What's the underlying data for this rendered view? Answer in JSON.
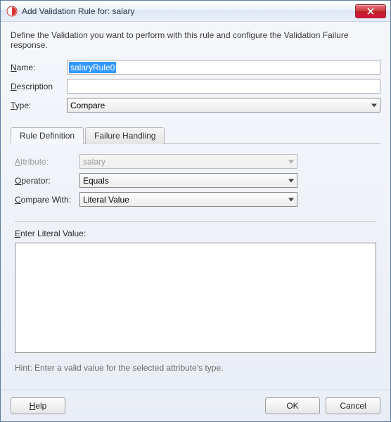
{
  "window": {
    "title": "Add Validation Rule for: salary"
  },
  "intro": "Define the Validation you want to perform with this rule and configure the Validation Failure response.",
  "fields": {
    "name_label": "Name:",
    "name_value": "salaryRule0",
    "description_label": "Description",
    "description_value": "",
    "type_label": "Type:",
    "type_value": "Compare"
  },
  "tabs": {
    "rule_definition": "Rule Definition",
    "failure_handling": "Failure Handling"
  },
  "rule_def": {
    "attribute_label": "Attribute:",
    "attribute_value": "salary",
    "operator_label": "Operator:",
    "operator_value": "Equals",
    "compare_with_label": "Compare With:",
    "compare_with_value": "Literal Value",
    "literal_label": "Enter Literal Value:",
    "literal_value": ""
  },
  "hint": "Hint: Enter a valid value for the selected attribute's type.",
  "buttons": {
    "help": "Help",
    "ok": "OK",
    "cancel": "Cancel"
  }
}
